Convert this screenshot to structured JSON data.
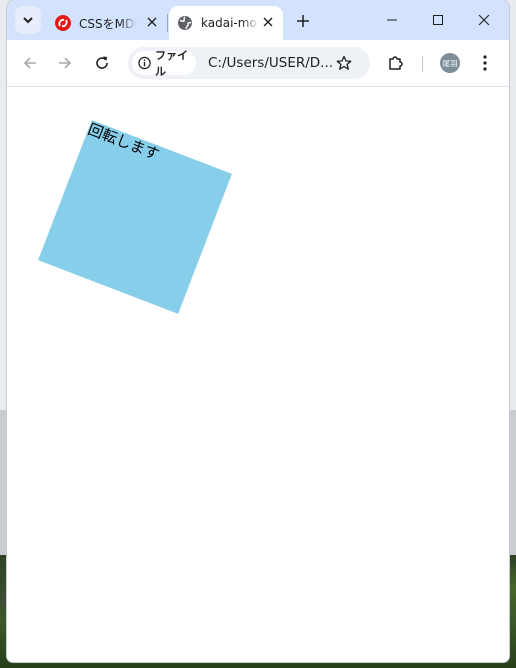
{
  "browser": {
    "tabs": [
      {
        "title": "CSSをMDN",
        "favicon": "red-swirl-icon",
        "active": false
      },
      {
        "title": "kadai-mo",
        "favicon": "globe-icon",
        "active": true
      }
    ],
    "address_bar": {
      "security_chip_label": "ファイル",
      "url": "C:/Users/USER/D..."
    },
    "profile_initials": "尾羽"
  },
  "page": {
    "box_text": "回転します",
    "box_color": "#87ceeb",
    "rotation_degrees": 21
  }
}
